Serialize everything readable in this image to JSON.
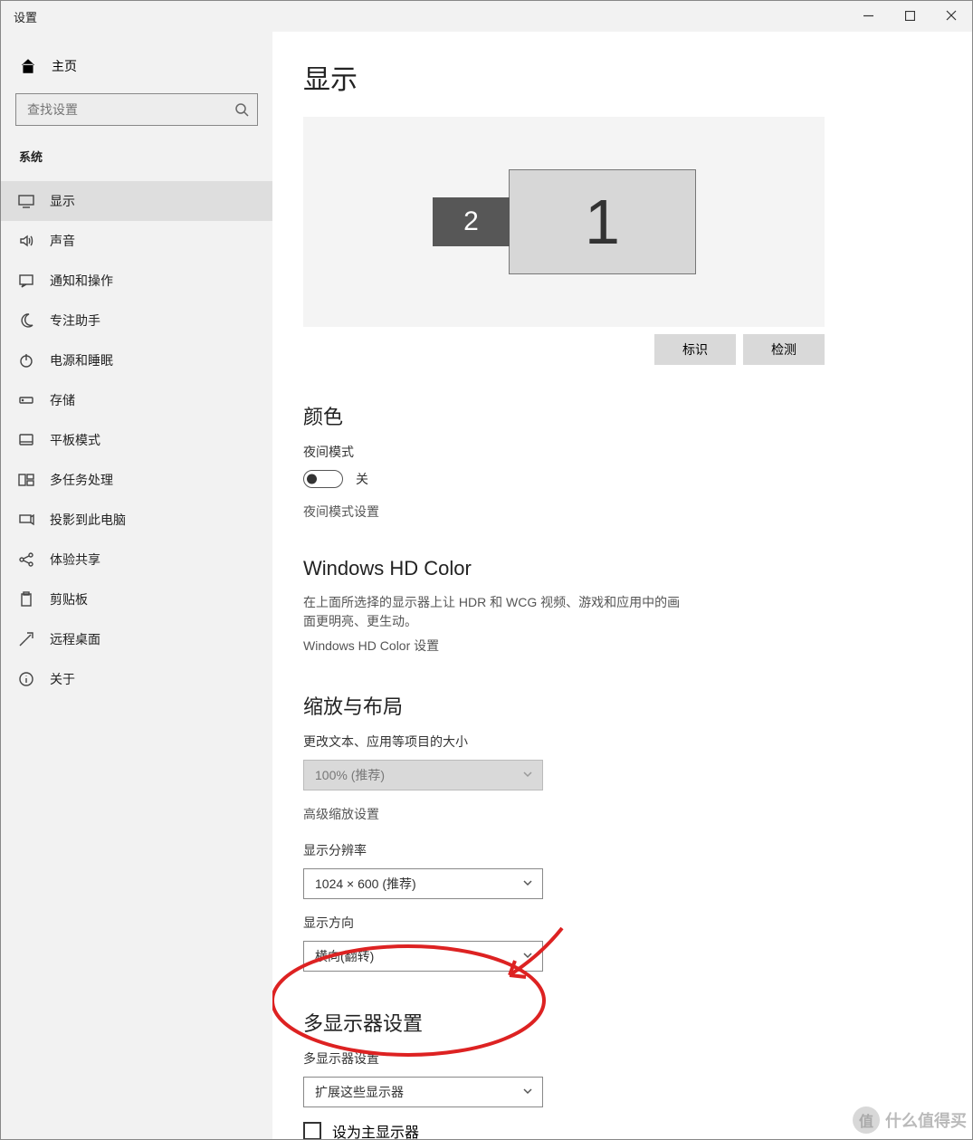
{
  "window": {
    "title": "设置"
  },
  "sidebar": {
    "home": "主页",
    "search_placeholder": "查找设置",
    "category": "系统",
    "items": [
      {
        "label": "显示"
      },
      {
        "label": "声音"
      },
      {
        "label": "通知和操作"
      },
      {
        "label": "专注助手"
      },
      {
        "label": "电源和睡眠"
      },
      {
        "label": "存储"
      },
      {
        "label": "平板模式"
      },
      {
        "label": "多任务处理"
      },
      {
        "label": "投影到此电脑"
      },
      {
        "label": "体验共享"
      },
      {
        "label": "剪贴板"
      },
      {
        "label": "远程桌面"
      },
      {
        "label": "关于"
      }
    ]
  },
  "main": {
    "title": "显示",
    "monitors": {
      "primary": "1",
      "secondary": "2"
    },
    "buttons": {
      "identify": "标识",
      "detect": "检测"
    },
    "color": {
      "heading": "颜色",
      "night_label": "夜间模式",
      "night_state": "关",
      "night_settings": "夜间模式设置"
    },
    "hd": {
      "heading": "Windows HD Color",
      "desc": "在上面所选择的显示器上让 HDR 和 WCG 视频、游戏和应用中的画面更明亮、更生动。",
      "link": "Windows HD Color 设置"
    },
    "scale": {
      "heading": "缩放与布局",
      "size_label": "更改文本、应用等项目的大小",
      "size_value": "100% (推荐)",
      "advanced": "高级缩放设置",
      "res_label": "显示分辨率",
      "res_value": "1024 × 600 (推荐)",
      "orient_label": "显示方向",
      "orient_value": "横向(翻转)"
    },
    "multi": {
      "heading": "多显示器设置",
      "label": "多显示器设置",
      "value": "扩展这些显示器",
      "primary_check": "设为主显示器"
    }
  },
  "watermark": "什么值得买"
}
